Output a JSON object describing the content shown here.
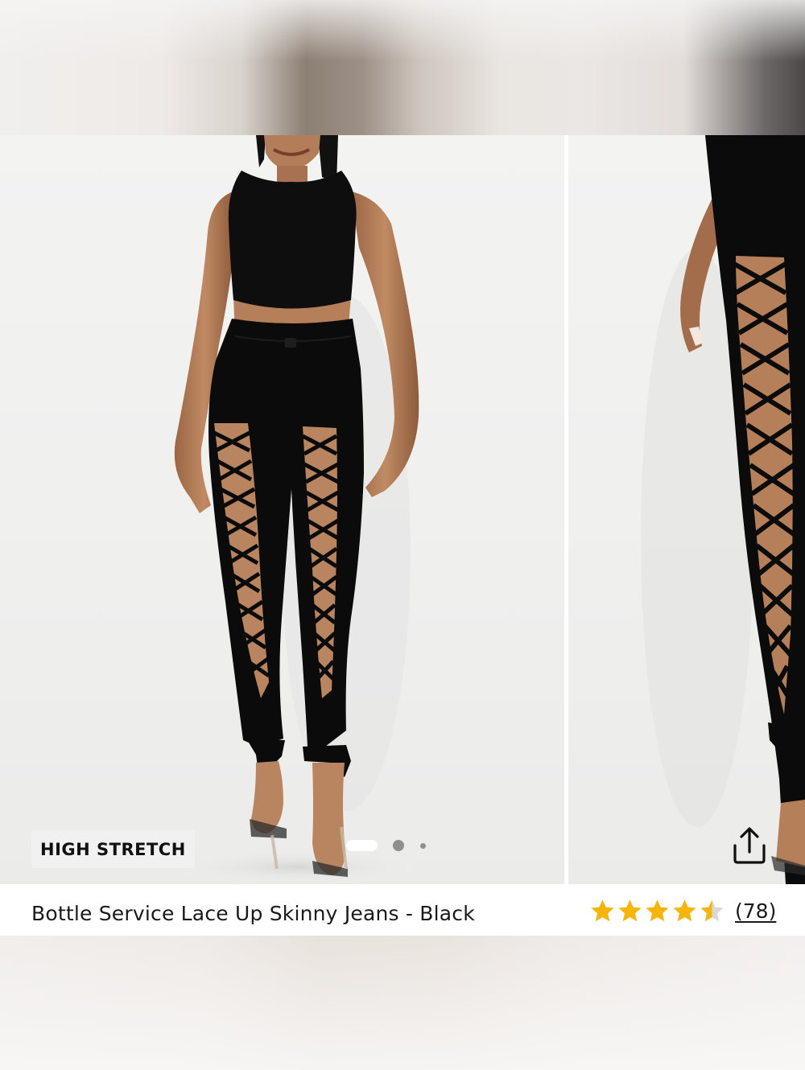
{
  "product": {
    "title": "Bottle Service Lace Up Skinny Jeans - Black",
    "badge": "HIGH STRETCH",
    "rating_value": 4.5,
    "rating_max": 5,
    "review_count_label": "(78)"
  },
  "gallery": {
    "slide_count": 3,
    "active_slide": 1,
    "images": [
      {
        "icon": "model-front-photo"
      },
      {
        "icon": "model-side-detail-photo"
      }
    ]
  },
  "icons": {
    "share": "share-icon",
    "star": "star-icon"
  },
  "colors": {
    "star": "#f5b50a",
    "star_empty": "#d8d8d8",
    "text": "#1a1a1a",
    "garment": "#0b0b0b",
    "skin": "#b07a56"
  }
}
